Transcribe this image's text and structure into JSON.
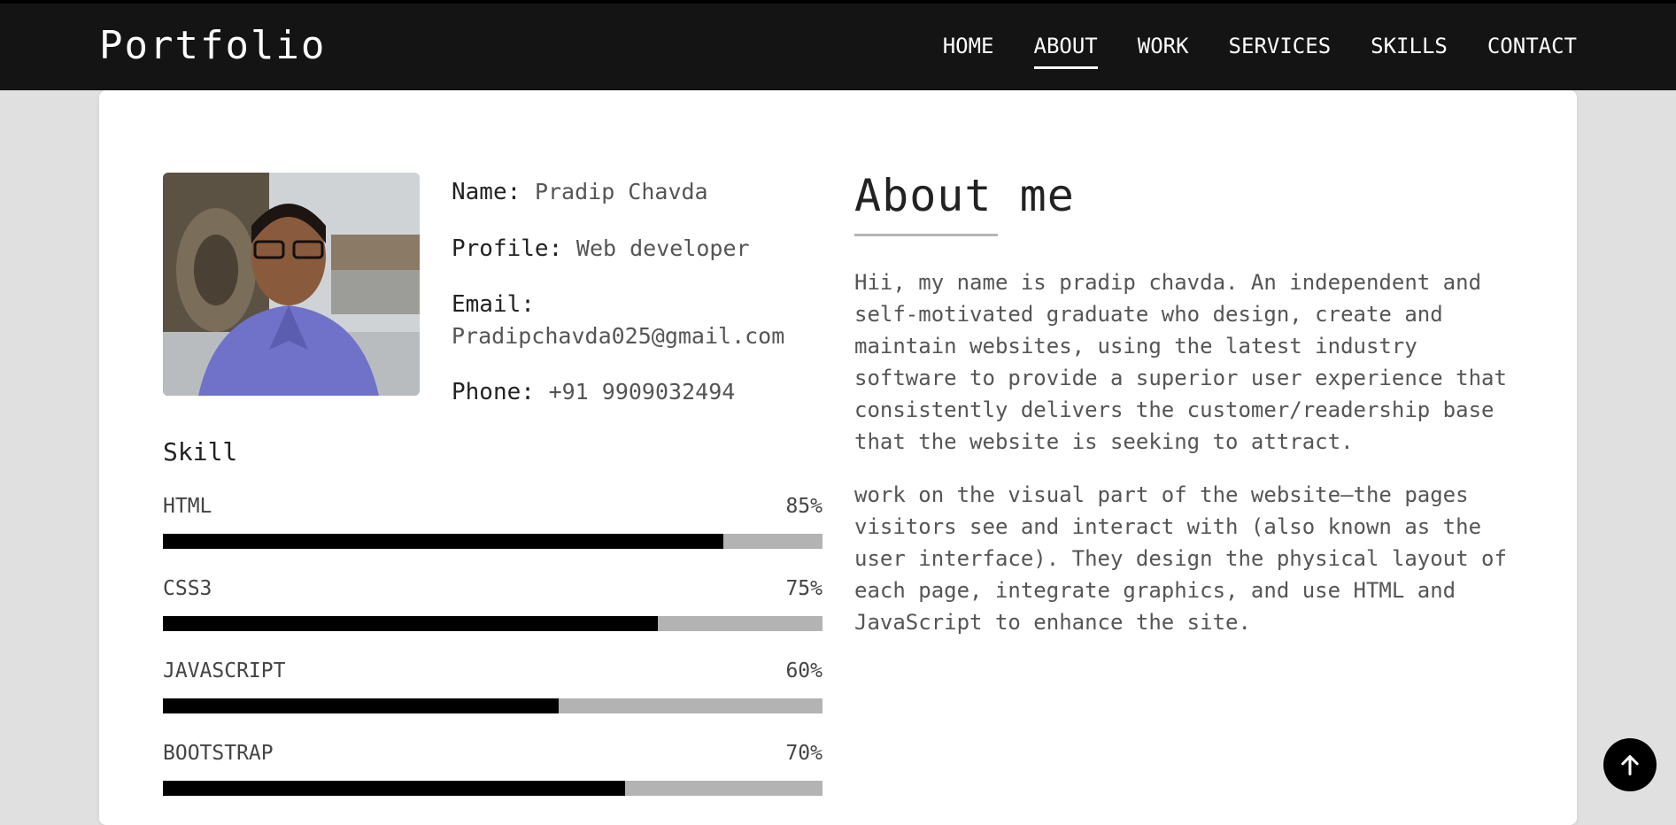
{
  "nav": {
    "brand": "Portfolio",
    "links": [
      "HOME",
      "ABOUT",
      "WORK",
      "SERVICES",
      "SKILLS",
      "CONTACT"
    ],
    "active": "ABOUT"
  },
  "profile": {
    "photo_icon": "profile-photo",
    "name_label": "Name:",
    "name_value": "Pradip Chavda",
    "profile_label": "Profile:",
    "profile_value": "Web developer",
    "email_label": "Email:",
    "email_value": "Pradipchavda025@gmail.com",
    "phone_label": "Phone:",
    "phone_value": "+91 9909032494"
  },
  "skills": {
    "title": "Skill",
    "items": [
      {
        "name": "HTML",
        "percent_label": "85%",
        "level": 85
      },
      {
        "name": "CSS3",
        "percent_label": "75%",
        "level": 75
      },
      {
        "name": "JAVASCRIPT",
        "percent_label": "60%",
        "level": 60
      },
      {
        "name": "BOOTSTRAP",
        "percent_label": "70%",
        "level": 70
      }
    ]
  },
  "about": {
    "title": "About me",
    "paragraph1": "Hii, my name is pradip chavda. An independent and self-motivated graduate who design, create and maintain websites, using the latest industry software to provide a superior user experience that consistently delivers the customer/readership base that the website is seeking to attract.",
    "paragraph2": "work on the visual part of the website—the pages visitors see and interact with (also known as the user interface). They design the physical layout of each page, integrate graphics, and use HTML and JavaScript to enhance the site."
  },
  "scroll_top": {
    "icon": "arrow-up-icon"
  },
  "colors": {
    "navbar": "#141414",
    "bar_fill": "#000000",
    "bar_track": "#b3b3b3",
    "background": "#e0e0e0"
  }
}
